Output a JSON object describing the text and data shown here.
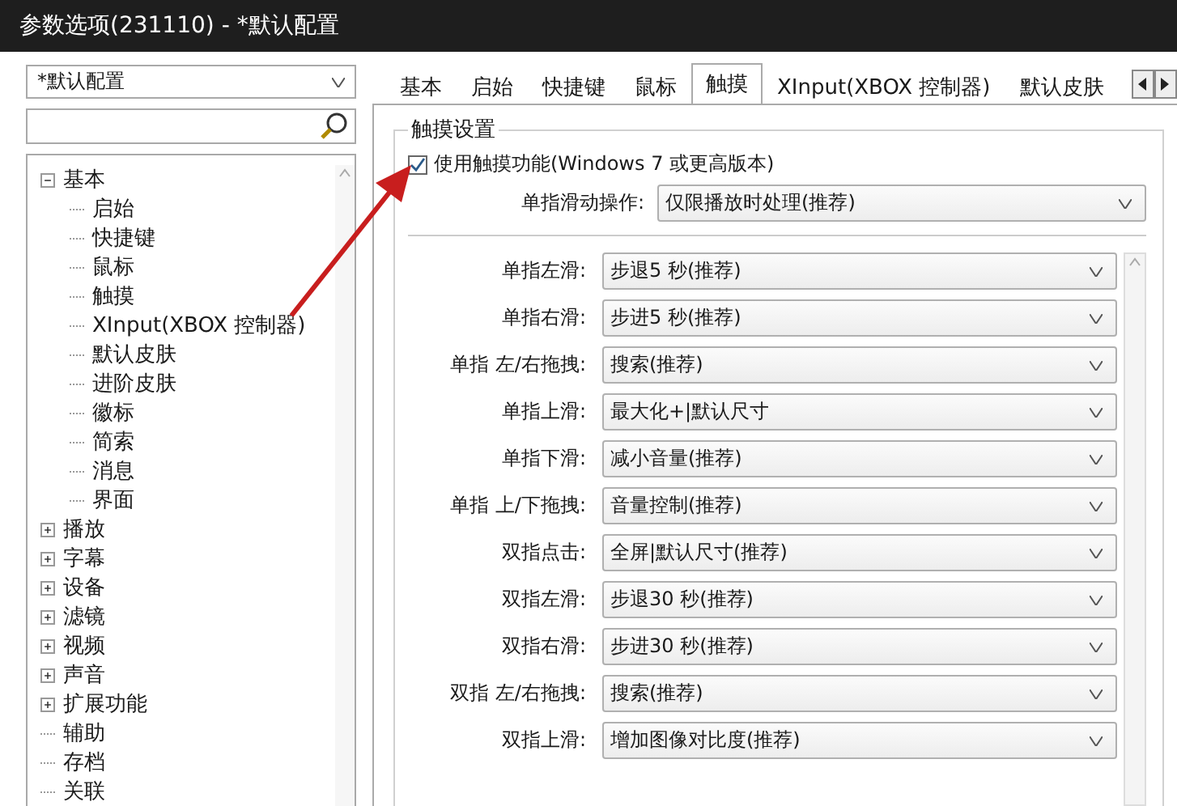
{
  "window": {
    "title": "参数选项(231110) - *默认配置"
  },
  "sidebar": {
    "profile": "*默认配置",
    "tree": [
      {
        "label": "基本",
        "kind": "folder",
        "expanded": true,
        "children": [
          {
            "label": "启始",
            "kind": "leaf"
          },
          {
            "label": "快捷键",
            "kind": "leaf"
          },
          {
            "label": "鼠标",
            "kind": "leaf"
          },
          {
            "label": "触摸",
            "kind": "leaf"
          },
          {
            "label": "XInput(XBOX 控制器)",
            "kind": "leaf"
          },
          {
            "label": "默认皮肤",
            "kind": "leaf"
          },
          {
            "label": "进阶皮肤",
            "kind": "leaf"
          },
          {
            "label": "徽标",
            "kind": "leaf"
          },
          {
            "label": "简索",
            "kind": "leaf"
          },
          {
            "label": "消息",
            "kind": "leaf"
          },
          {
            "label": "界面",
            "kind": "leaf"
          }
        ]
      },
      {
        "label": "播放",
        "kind": "folder",
        "expanded": false
      },
      {
        "label": "字幕",
        "kind": "folder",
        "expanded": false
      },
      {
        "label": "设备",
        "kind": "folder",
        "expanded": false
      },
      {
        "label": "滤镜",
        "kind": "folder",
        "expanded": false
      },
      {
        "label": "视频",
        "kind": "folder",
        "expanded": false
      },
      {
        "label": "声音",
        "kind": "folder",
        "expanded": false
      },
      {
        "label": "扩展功能",
        "kind": "folder",
        "expanded": false
      },
      {
        "label": "辅助",
        "kind": "leaf"
      },
      {
        "label": "存档",
        "kind": "leaf"
      },
      {
        "label": "关联",
        "kind": "leaf"
      }
    ]
  },
  "tabs": [
    {
      "label": "基本",
      "selected": false
    },
    {
      "label": "启始",
      "selected": false
    },
    {
      "label": "快捷键",
      "selected": false
    },
    {
      "label": "鼠标",
      "selected": false
    },
    {
      "label": "触摸",
      "selected": true
    },
    {
      "label": "XInput(XBOX 控制器)",
      "selected": false
    },
    {
      "label": "默认皮肤",
      "selected": false
    }
  ],
  "group": {
    "title": "触摸设置",
    "enable": {
      "label": "使用触摸功能(Windows 7 或更高版本)",
      "checked": true
    },
    "slide_mode": {
      "label": "单指滑动操作:",
      "value": "仅限播放时处理(推荐)"
    },
    "gestures": [
      {
        "label": "单指左滑:",
        "value": "步退5 秒(推荐)"
      },
      {
        "label": "单指右滑:",
        "value": "步进5 秒(推荐)"
      },
      {
        "label": "单指 左/右拖拽:",
        "value": "搜索(推荐)"
      },
      {
        "label": "单指上滑:",
        "value": "最大化+|默认尺寸"
      },
      {
        "label": "单指下滑:",
        "value": "减小音量(推荐)"
      },
      {
        "label": "单指 上/下拖拽:",
        "value": "音量控制(推荐)"
      },
      {
        "label": "双指点击:",
        "value": "全屏|默认尺寸(推荐)"
      },
      {
        "label": "双指左滑:",
        "value": "步退30 秒(推荐)"
      },
      {
        "label": "双指右滑:",
        "value": "步进30 秒(推荐)"
      },
      {
        "label": "双指 左/右拖拽:",
        "value": "搜索(推荐)"
      },
      {
        "label": "双指上滑:",
        "value": "增加图像对比度(推荐)"
      }
    ]
  }
}
